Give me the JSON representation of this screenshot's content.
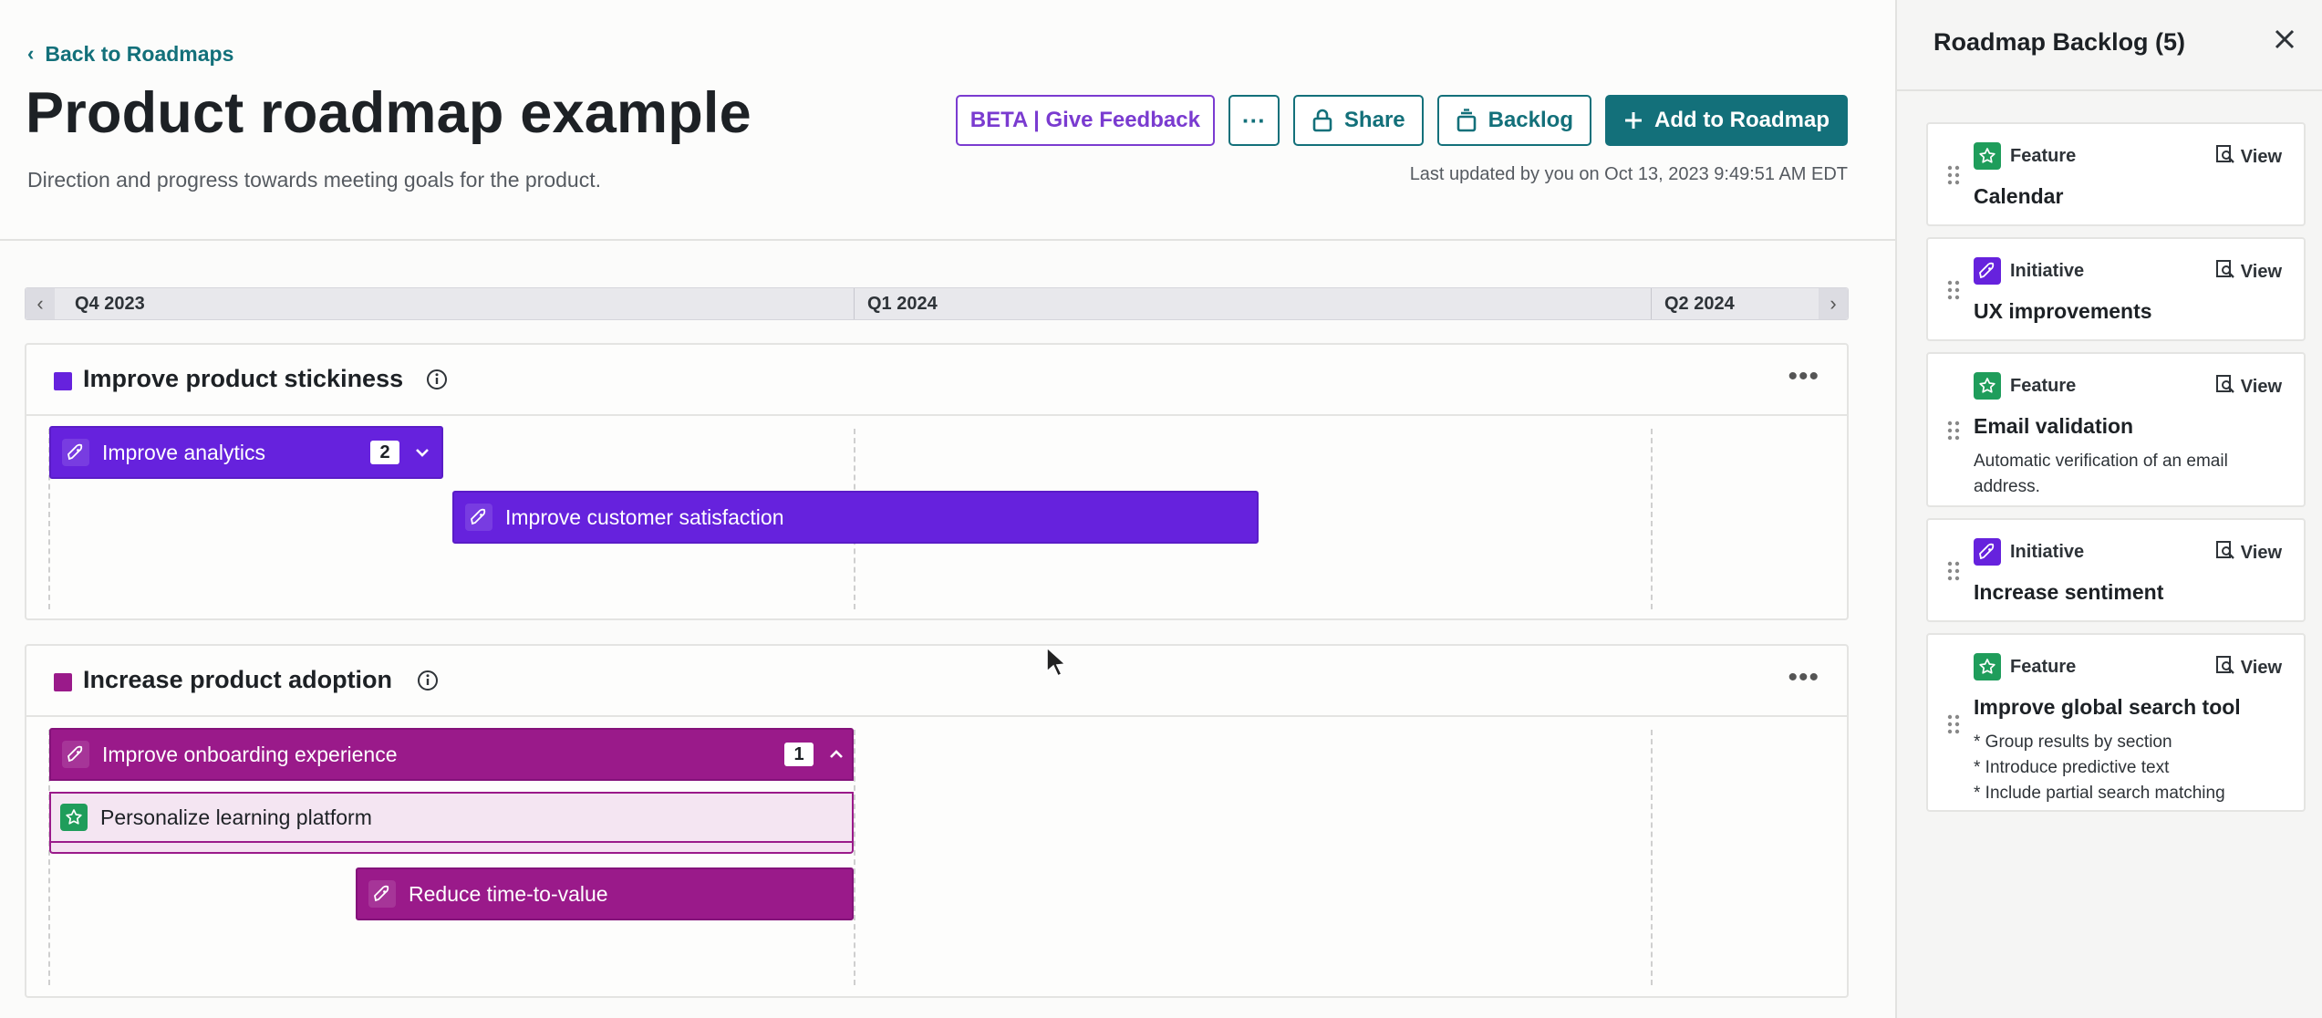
{
  "header": {
    "back_label": "Back to Roadmaps",
    "title": "Product roadmap example",
    "description": "Direction and progress towards meeting goals for the product.",
    "last_updated": "Last updated by you on Oct 13, 2023 9:49:51 AM EDT",
    "buttons": {
      "beta": "BETA | Give Feedback",
      "more": "···",
      "share": "Share",
      "backlog": "Backlog",
      "add": "Add to Roadmap"
    }
  },
  "timeline": {
    "quarters": [
      "Q4 2023",
      "Q1 2024",
      "Q2 2024"
    ]
  },
  "goals": [
    {
      "title": "Improve product stickiness",
      "color": "#6622dd",
      "bars": [
        {
          "label": "Improve analytics",
          "count": "2"
        },
        {
          "label": "Improve customer satisfaction"
        }
      ]
    },
    {
      "title": "Increase product adoption",
      "color": "#9a1a8a",
      "bars": [
        {
          "label": "Improve onboarding experience",
          "count": "1",
          "child": "Personalize learning platform"
        },
        {
          "label": "Reduce time-to-value"
        }
      ]
    }
  ],
  "backlog": {
    "title": "Roadmap Backlog (5)",
    "view_label": "View",
    "items": [
      {
        "type": "Feature",
        "name": "Calendar"
      },
      {
        "type": "Initiative",
        "name": "UX improvements"
      },
      {
        "type": "Feature",
        "name": "Email validation",
        "desc": "Automatic verification of an email address."
      },
      {
        "type": "Initiative",
        "name": "Increase sentiment"
      },
      {
        "type": "Feature",
        "name": "Improve global search tool",
        "desc_lines": [
          "* Group results by section",
          "* Introduce predictive text",
          "* Include partial search matching"
        ]
      }
    ]
  },
  "colors": {
    "accent": "#13707a",
    "initiative": "#6622dd",
    "adoption": "#9a1a8a",
    "feature": "#1f9d5b",
    "beta": "#7a3bd0"
  }
}
